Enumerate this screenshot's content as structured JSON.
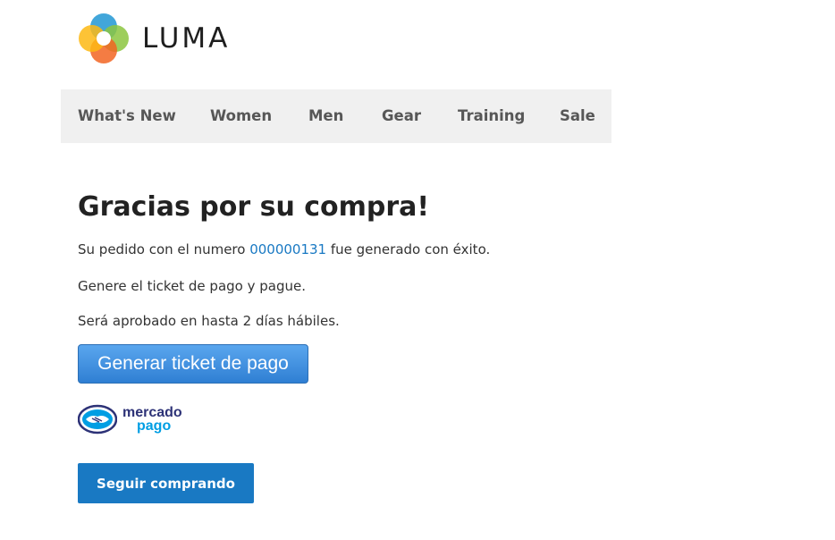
{
  "logo": {
    "text": "LUMA",
    "icon": "luma-logo-icon"
  },
  "nav": {
    "items": [
      {
        "label": "What's New"
      },
      {
        "label": "Women"
      },
      {
        "label": "Men"
      },
      {
        "label": "Gear"
      },
      {
        "label": "Training"
      },
      {
        "label": "Sale"
      }
    ]
  },
  "main": {
    "title": "Gracias por su compra!",
    "order_prefix": "Su pedido con el numero ",
    "order_number": "000000131",
    "order_suffix": " fue generado con éxito.",
    "instruction": "Genere el ticket de pago y pague.",
    "approval_note": "Será aprobado en hasta 2 días hábiles.",
    "ticket_button_label": "Generar ticket de pago",
    "payment_provider": {
      "name_line1": "mercado",
      "name_line2": "pago",
      "icon": "handshake-icon"
    },
    "continue_button_label": "Seguir comprando"
  },
  "colors": {
    "link": "#1979c3",
    "primary_button": "#1979c3",
    "nav_background": "#f0f0f0",
    "mp_dark": "#2d3277",
    "mp_light": "#009ee3"
  }
}
